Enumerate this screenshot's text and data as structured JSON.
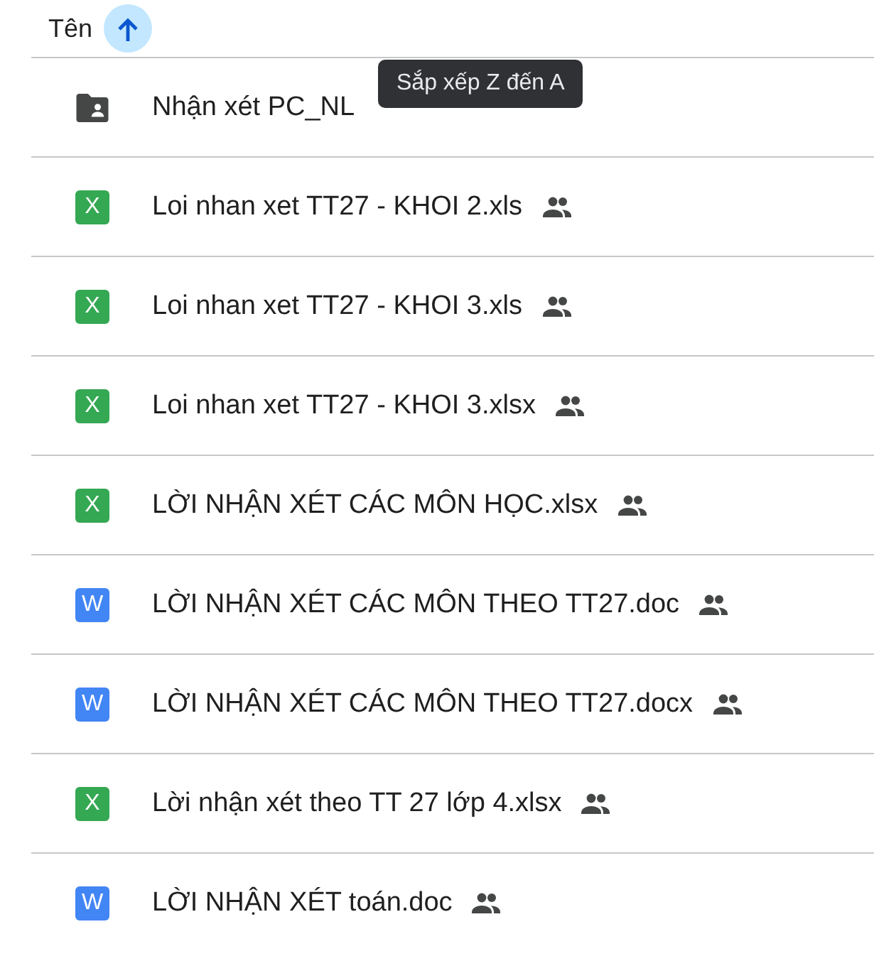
{
  "header": {
    "label": "Tên"
  },
  "files": [
    {
      "kind": "folder",
      "name": "Nhận xét PC_NL",
      "shared": false
    },
    {
      "kind": "sheet",
      "badge": "X",
      "name": "Loi nhan xet TT27 - KHOI 2.xls",
      "shared": true
    },
    {
      "kind": "sheet",
      "badge": "X",
      "name": "Loi nhan xet TT27 - KHOI 3.xls",
      "shared": true
    },
    {
      "kind": "sheet",
      "badge": "X",
      "name": "Loi nhan xet TT27 - KHOI 3.xlsx",
      "shared": true
    },
    {
      "kind": "sheet",
      "badge": "X",
      "name": "LỜI NHẬN XÉT CÁC MÔN HỌC.xlsx",
      "shared": true
    },
    {
      "kind": "doc",
      "badge": "W",
      "name": "LỜI NHẬN XÉT CÁC MÔN THEO TT27.doc",
      "shared": true
    },
    {
      "kind": "doc",
      "badge": "W",
      "name": "LỜI NHẬN XÉT CÁC MÔN THEO TT27.docx",
      "shared": true
    },
    {
      "kind": "sheet",
      "badge": "X",
      "name": "Lời nhận xét theo TT 27 lớp 4.xlsx",
      "shared": true
    },
    {
      "kind": "doc",
      "badge": "W",
      "name": "LỜI NHẬN XÉT toán.doc",
      "shared": true
    }
  ],
  "tooltip": "Sắp xếp Z đến A"
}
